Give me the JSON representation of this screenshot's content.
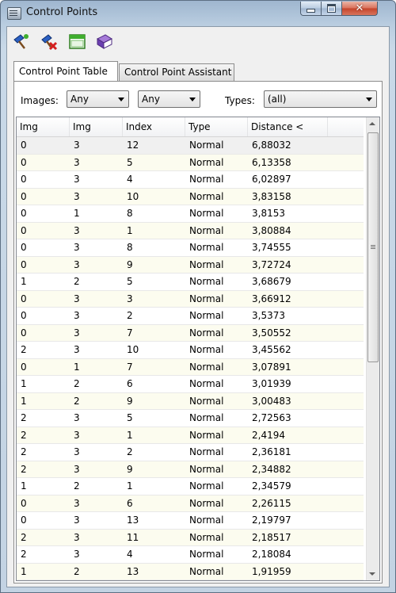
{
  "window": {
    "title": "Control Points"
  },
  "toolbar": {
    "buttons": [
      {
        "name": "add-control-point-icon"
      },
      {
        "name": "delete-control-point-icon"
      },
      {
        "name": "window-icon"
      },
      {
        "name": "book-icon"
      }
    ]
  },
  "tabs": [
    {
      "label": "Control Point Table",
      "active": true
    },
    {
      "label": "Control Point Assistant",
      "active": false
    }
  ],
  "filters": {
    "images_label": "Images:",
    "image_a": "Any",
    "image_b": "Any",
    "types_label": "Types:",
    "types": "(all)"
  },
  "table": {
    "columns": [
      "Img",
      "Img",
      "Index",
      "Type",
      "Distance <"
    ],
    "rows": [
      [
        "0",
        "3",
        "12",
        "Normal",
        "6,88032"
      ],
      [
        "0",
        "3",
        "5",
        "Normal",
        "6,13358"
      ],
      [
        "0",
        "3",
        "4",
        "Normal",
        "6,02897"
      ],
      [
        "0",
        "3",
        "10",
        "Normal",
        "3,83158"
      ],
      [
        "0",
        "1",
        "8",
        "Normal",
        "3,8153"
      ],
      [
        "0",
        "3",
        "1",
        "Normal",
        "3,80884"
      ],
      [
        "0",
        "3",
        "8",
        "Normal",
        "3,74555"
      ],
      [
        "0",
        "3",
        "9",
        "Normal",
        "3,72724"
      ],
      [
        "1",
        "2",
        "5",
        "Normal",
        "3,68679"
      ],
      [
        "0",
        "3",
        "3",
        "Normal",
        "3,66912"
      ],
      [
        "0",
        "3",
        "2",
        "Normal",
        "3,5373"
      ],
      [
        "0",
        "3",
        "7",
        "Normal",
        "3,50552"
      ],
      [
        "2",
        "3",
        "10",
        "Normal",
        "3,45562"
      ],
      [
        "0",
        "1",
        "7",
        "Normal",
        "3,07891"
      ],
      [
        "1",
        "2",
        "6",
        "Normal",
        "3,01939"
      ],
      [
        "1",
        "2",
        "9",
        "Normal",
        "3,00483"
      ],
      [
        "2",
        "3",
        "5",
        "Normal",
        "2,72563"
      ],
      [
        "2",
        "3",
        "1",
        "Normal",
        "2,4194"
      ],
      [
        "2",
        "3",
        "2",
        "Normal",
        "2,36181"
      ],
      [
        "2",
        "3",
        "9",
        "Normal",
        "2,34882"
      ],
      [
        "1",
        "2",
        "1",
        "Normal",
        "2,34579"
      ],
      [
        "0",
        "3",
        "6",
        "Normal",
        "2,26115"
      ],
      [
        "0",
        "3",
        "13",
        "Normal",
        "2,19797"
      ],
      [
        "2",
        "3",
        "11",
        "Normal",
        "2,18517"
      ],
      [
        "2",
        "3",
        "4",
        "Normal",
        "2,18084"
      ],
      [
        "1",
        "2",
        "13",
        "Normal",
        "1,91959"
      ]
    ]
  }
}
